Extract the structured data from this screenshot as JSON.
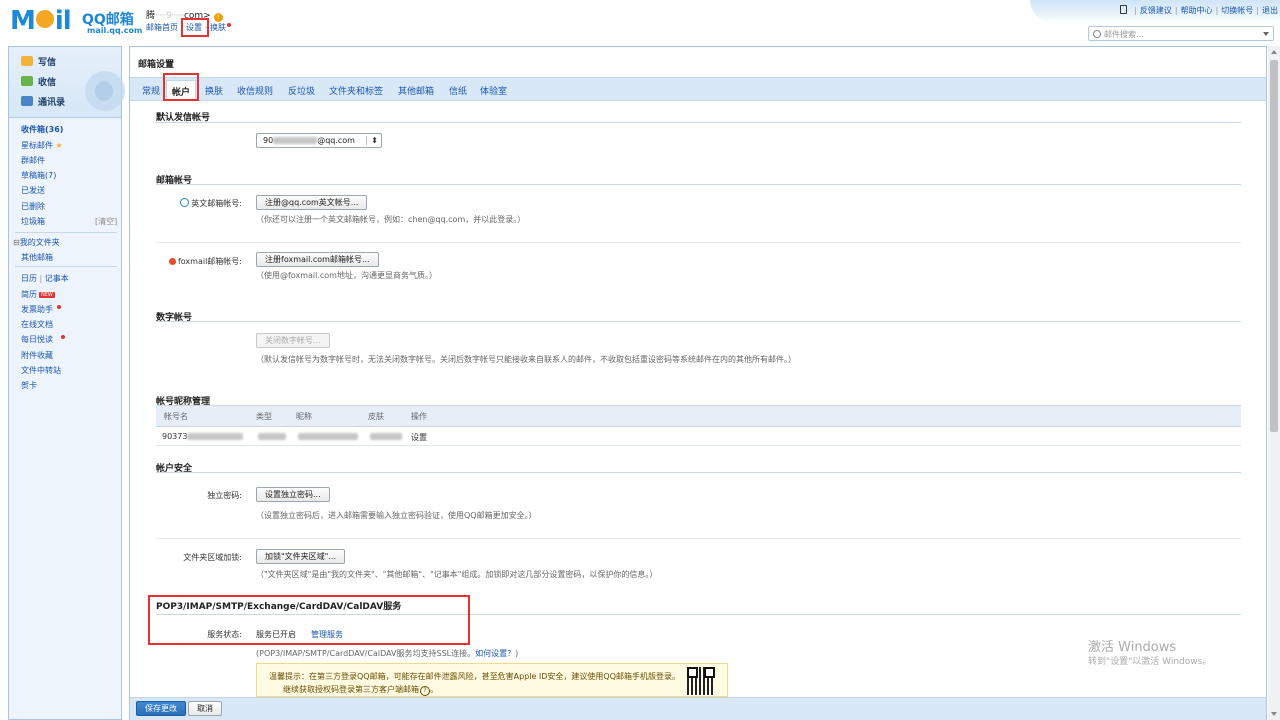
{
  "header": {
    "logo_left": "M",
    "logo_right": "il",
    "logo_cn": "QQ邮箱",
    "logo_en": "mail.qq.com",
    "user_prefix": "腾",
    "user_masked": "······9·······",
    "user_suffix": "com>",
    "warn_symbol": "!",
    "links": {
      "home": "邮箱首页",
      "settings": "设置",
      "sep": "-",
      "skin": "换肤"
    },
    "right_links": [
      "反馈建议",
      "帮助中心",
      "切换帐号",
      "退出"
    ],
    "right_sep": "|",
    "search_placeholder": "邮件搜索..."
  },
  "sidebar": {
    "buttons": {
      "write": "写信",
      "receive": "收信",
      "contacts": "通讯录"
    },
    "inbox": "收件箱(36)",
    "star": "星标邮件",
    "star_glyph": "★",
    "group": "群邮件",
    "drafts": "草稿箱(7)",
    "sent": "已发送",
    "deleted": "已删除",
    "trash": "垃圾箱",
    "trash_empty": "[清空]",
    "my_folders_toggle": "⊟",
    "my_folders": "我的文件夹",
    "other_mail": "其他邮箱",
    "calendar": "日历",
    "cal_sep": "|",
    "notes": "记事本",
    "resume": "简历",
    "new_badge": "NEW",
    "invoice": "发票助手",
    "docs": "在线文档",
    "daily": "每日悦读",
    "attachments": "附件收藏",
    "transfer": "文件中转站",
    "cards": "贺卡"
  },
  "main": {
    "title": "邮箱设置",
    "tabs": [
      "常规",
      "帐户",
      "换肤",
      "收信规则",
      "反垃圾",
      "文件夹和标签",
      "其他邮箱",
      "信纸",
      "体验室"
    ],
    "active_tab": 1,
    "sections": {
      "default_sender": {
        "title": "默认发信帐号",
        "selected_prefix": "90",
        "selected_suffix": "@qq.com",
        "arrow": "⬍"
      },
      "mail_accounts": {
        "title": "邮箱帐号",
        "english_label": "英文邮箱帐号:",
        "english_button": "注册@qq.com英文帐号...",
        "english_hint": "（你还可以注册一个英文邮箱帐号，例如：chen@qq.com，并以此登录。）",
        "foxmail_label": "foxmail邮箱帐号:",
        "foxmail_button": "注册foxmail.com邮箱帐号...",
        "foxmail_hint": "（使用@foxmail.com地址，沟通更显商务气质。）"
      },
      "digital": {
        "title": "数字帐号",
        "button": "关闭数字帐号...",
        "hint": "（默认发信帐号为数字帐号时，无法关闭数字帐号。关闭后数字帐号只能接收来自联系人的邮件，不收取包括重设密码等系统邮件在内的其他所有邮件。）"
      },
      "nickname": {
        "title": "帐号昵称管理",
        "headers": [
          "帐号名",
          "类型",
          "昵称",
          "皮肤",
          "操作"
        ],
        "row_account": "90373",
        "row_action": "设置"
      },
      "security": {
        "title": "帐户安全",
        "pwd_label": "独立密码:",
        "pwd_button": "设置独立密码...",
        "pwd_hint": "（设置独立密码后，进入邮箱需要输入独立密码验证，使用QQ邮箱更加安全。）",
        "folder_label": "文件夹区域加锁:",
        "folder_button": "加锁\"文件夹区域\"...",
        "folder_hint": "（\"文件夹区域\"是由\"我的文件夹\"、\"其他邮箱\"、\"记事本\"组成。加锁即对这几部分设置密码，以保护你的信息。）"
      },
      "pop": {
        "title": "POP3/IMAP/SMTP/Exchange/CardDAV/CalDAV服务",
        "status_label": "服务状态:",
        "status_value": "服务已开启",
        "manage_link": "管理服务",
        "ssl_hint": "(POP3/IMAP/SMTP/CardDAV/CalDAV服务均支持SSL连接。",
        "how_link": "如何设置？",
        "ssl_hint_end": ")",
        "tip_line1": "温馨提示：在第三方登录QQ邮箱，可能存在邮件泄露风险，甚至危害Apple ID安全，建议使用QQ邮箱手机版登录。",
        "tip_line2": "继续获取授权码登录第三方客户端邮箱",
        "tip_help": "?",
        "tip_end": "。"
      }
    },
    "footer": {
      "save": "保存更改",
      "cancel": "取消"
    }
  },
  "watermark": {
    "line1": "激活 Windows",
    "line2": "转到\"设置\"以激活 Windows。"
  },
  "colors": {
    "accent": "#1a56b0",
    "highlight": "#e53333",
    "tabbar": "#d9e8f7"
  }
}
